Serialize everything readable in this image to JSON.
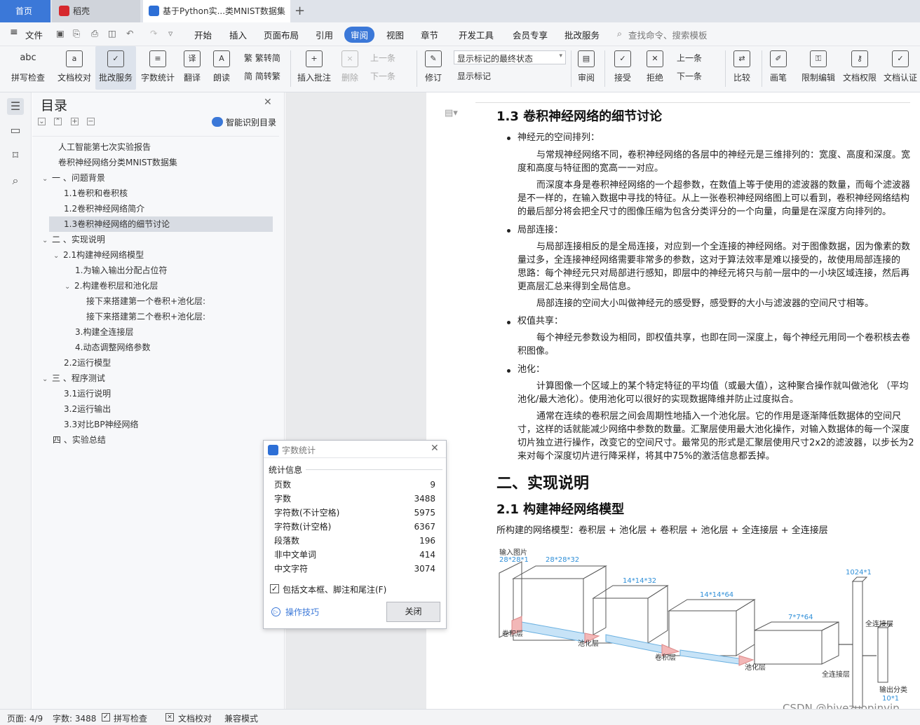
{
  "tabs": {
    "home": "首页",
    "daoke": "稻壳",
    "doc": "基于Python实...类MNIST数据集",
    "add": "+"
  },
  "menubar": {
    "file": "文件",
    "items": [
      "开始",
      "插入",
      "页面布局",
      "引用",
      "审阅",
      "视图",
      "章节",
      "开发工具",
      "会员专享",
      "批改服务"
    ],
    "search": "查找命令、搜索模板"
  },
  "ribbon": {
    "spellcheck": "拼写检查",
    "doc_proof": "文档校对",
    "correction": "批改服务",
    "word_count": "字数统计",
    "translate": "翻译",
    "read_aloud": "朗读",
    "to_traditional": "繁转简",
    "to_simplified": "简转繁",
    "insert_comment": "插入批注",
    "delete": "删除",
    "prev": "上一条",
    "next": "下一条",
    "track": "修订",
    "show_state": "显示标记的最终状态",
    "show_marks": "显示标记",
    "review": "审阅",
    "accept": "接受",
    "reject": "拒绝",
    "prev2": "上一条",
    "next2": "下一条",
    "compare": "比较",
    "pen": "画笔",
    "restrict": "限制编辑",
    "doc_perm": "文档权限",
    "doc_cert": "文档认证"
  },
  "toc": {
    "title": "目录",
    "smart": "智能识别目录",
    "items": [
      "人工智能第七次实验报告",
      "卷积神经网络分类MNIST数据集",
      "一 、问题背景",
      "1.1卷积和卷积核",
      "1.2卷积神经网络简介",
      "1.3卷积神经网络的细节讨论",
      "二 、实现说明",
      "2.1构建神经网络模型",
      "1.为输入输出分配占位符",
      "2.构建卷积层和池化层",
      "接下来搭建第一个卷积+池化层:",
      "接下来搭建第二个卷积+池化层:",
      "3.构建全连接层",
      "4.动态调整网络参数",
      "2.2运行模型",
      "三 、程序测试",
      "3.1运行说明",
      "3.2运行输出",
      "3.3对比BP神经网络",
      "四 、实验总结"
    ]
  },
  "dialog": {
    "title": "字数统计",
    "section": "统计信息",
    "rows": [
      {
        "k": "页数",
        "v": "9"
      },
      {
        "k": "字数",
        "v": "3488"
      },
      {
        "k": "字符数(不计空格)",
        "v": "5975"
      },
      {
        "k": "字符数(计空格)",
        "v": "6367"
      },
      {
        "k": "段落数",
        "v": "196"
      },
      {
        "k": "非中文单词",
        "v": "414"
      },
      {
        "k": "中文字符",
        "v": "3074"
      }
    ],
    "checkbox": "包括文本框、脚注和尾注(F)",
    "tips": "操作技巧",
    "close": "关闭"
  },
  "doc": {
    "h13": "1.3 卷积神经网络的细节讨论",
    "b1": "神经元的空间排列：",
    "p1a": "与常规神经网络不同，卷积神经网络的各层中的神经元是三维排列的：宽度、高度和深度。宽",
    "p1b": "度和高度与特征图的宽高一一对应。",
    "p2a": "而深度本身是卷积神经网络的一个超参数，在数值上等于使用的滤波器的数量，而每个滤波器",
    "p2b": "是不一样的，在输入数据中寻找的特征。从上一张卷积神经网络图上可以看到，卷积神经网络结构",
    "p2c": "的最后部分将会把全尺寸的图像压缩为包含分类评分的一个向量，向量是在深度方向排列的。",
    "b2": "局部连接：",
    "p3a": "与局部连接相反的是全局连接，对应到一个全连接的神经网络。对于图像数据，因为像素的数",
    "p3b": "量过多，全连接神经网络需要非常多的参数，这对于算法效率是难以接受的，故使用局部连接的",
    "p3c": "思路：每个神经元只对局部进行感知，即层中的神经元将只与前一层中的一小块区域连接，然后再",
    "p3d": "更高层汇总来得到全局信息。",
    "p4": "局部连接的空间大小叫做神经元的感受野，感受野的大小与滤波器的空间尺寸相等。",
    "b3": "权值共享：",
    "p5a": "每个神经元参数设为相同，即权值共享，也即在同一深度上，每个神经元用同一个卷积核去卷",
    "p5b": "积图像。",
    "b4": "池化：",
    "p6a": "计算图像一个区域上的某个特定特征的平均值（或最大值），这种聚合操作就叫做池化 （平均",
    "p6b": "池化/最大池化）。使用池化可以很好的实现数据降维并防止过度拟合。",
    "p7a": "通常在连续的卷积层之间会周期性地插入一个池化层。它的作用是逐渐降低数据体的空间尺",
    "p7b": "寸，这样的话就能减少网络中参数的数量。汇聚层使用最大池化操作，对输入数据体的每一个深度",
    "p7c": "切片独立进行操作，改变它的空间尺寸。最常见的形式是汇聚层使用尺寸2x2的滤波器，以步长为2",
    "p7d": "来对每个深度切片进行降采样，将其中75%的激活信息都丢掉。",
    "h2": "二、实现说明",
    "h21": "2.1 构建神经网络模型",
    "p8": "所构建的网络模型：卷积层 + 池化层 + 卷积层 + 池化层 + 全连接层 + 全连接层",
    "fig": {
      "input": "输入图片",
      "d1": "28*28*1",
      "d2": "28*28*32",
      "d3": "14*14*32",
      "d4": "14*14*64",
      "d5": "7*7*64",
      "d6": "1024*1",
      "d7": "10*1",
      "conv1": "卷积层",
      "pool1": "池化层",
      "conv2": "卷积层",
      "pool2": "池化层",
      "fc1": "全连接层",
      "fc2": "全连接层",
      "out": "输出分类"
    }
  },
  "watermark": "CSDN @biyezuopinvip",
  "status": {
    "page": "页面: 4/9",
    "words": "字数: 3488",
    "spell": "拼写检查",
    "proof": "文档校对",
    "compat": "兼容模式"
  },
  "colors": {
    "accent": "#3b78d8",
    "link": "#3b78d8",
    "fig_label": "#2f8fd8"
  }
}
